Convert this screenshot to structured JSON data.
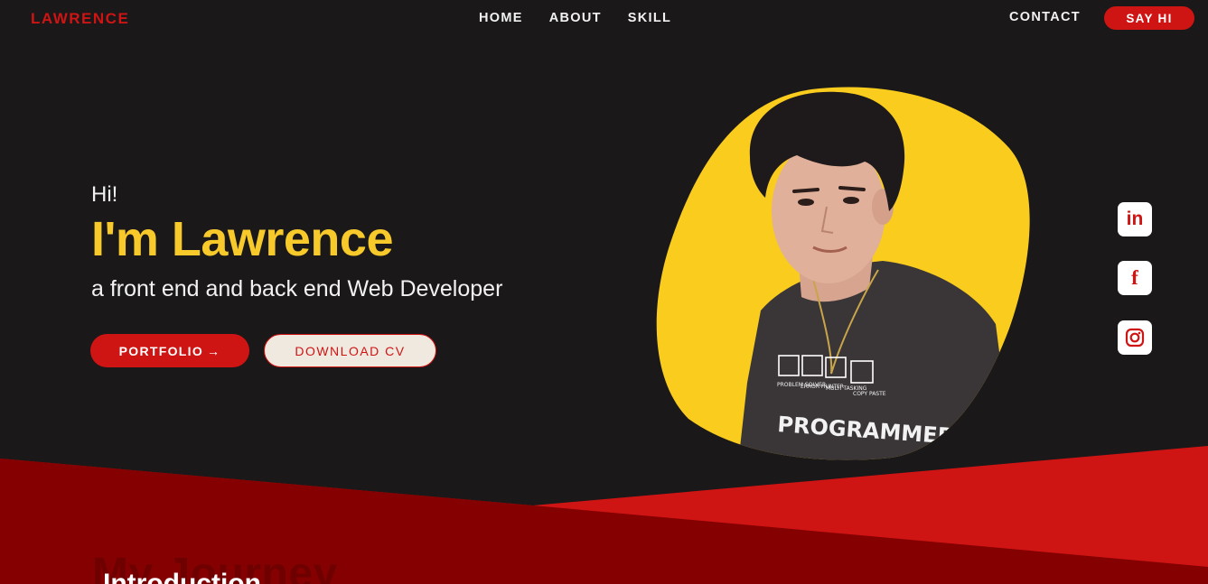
{
  "nav": {
    "logo": "LAWRENCE",
    "links": [
      "HOME",
      "ABOUT",
      "SKILL"
    ],
    "contact": "CONTACT",
    "cta": "SAY HI"
  },
  "hero": {
    "greeting": "Hi!",
    "name": "I'm Lawrence",
    "tagline": "a front end and back end Web Developer",
    "portfolio_button": "PORTFOLIO",
    "portfolio_arrow": "→",
    "cv_button": "DOWNLOAD CV"
  },
  "portrait": {
    "shirt_text": "PROGRAMMER",
    "shirt_captions": [
      "PROBLEM SOLVER",
      "ERROR HUNTER",
      "MULTI TASKING",
      "COPY PASTE"
    ]
  },
  "social": {
    "linkedin_label": "in",
    "facebook_label": "f",
    "icons": [
      "linkedin-icon",
      "facebook-icon",
      "instagram-icon"
    ]
  },
  "section": {
    "background_title": "My Journey",
    "heading": "Introduction"
  },
  "colors": {
    "background": "#1b1819",
    "accent_red": "#cf1414",
    "dark_red": "#850000",
    "yellow": "#f7c92b",
    "cream": "#efe9e0"
  }
}
